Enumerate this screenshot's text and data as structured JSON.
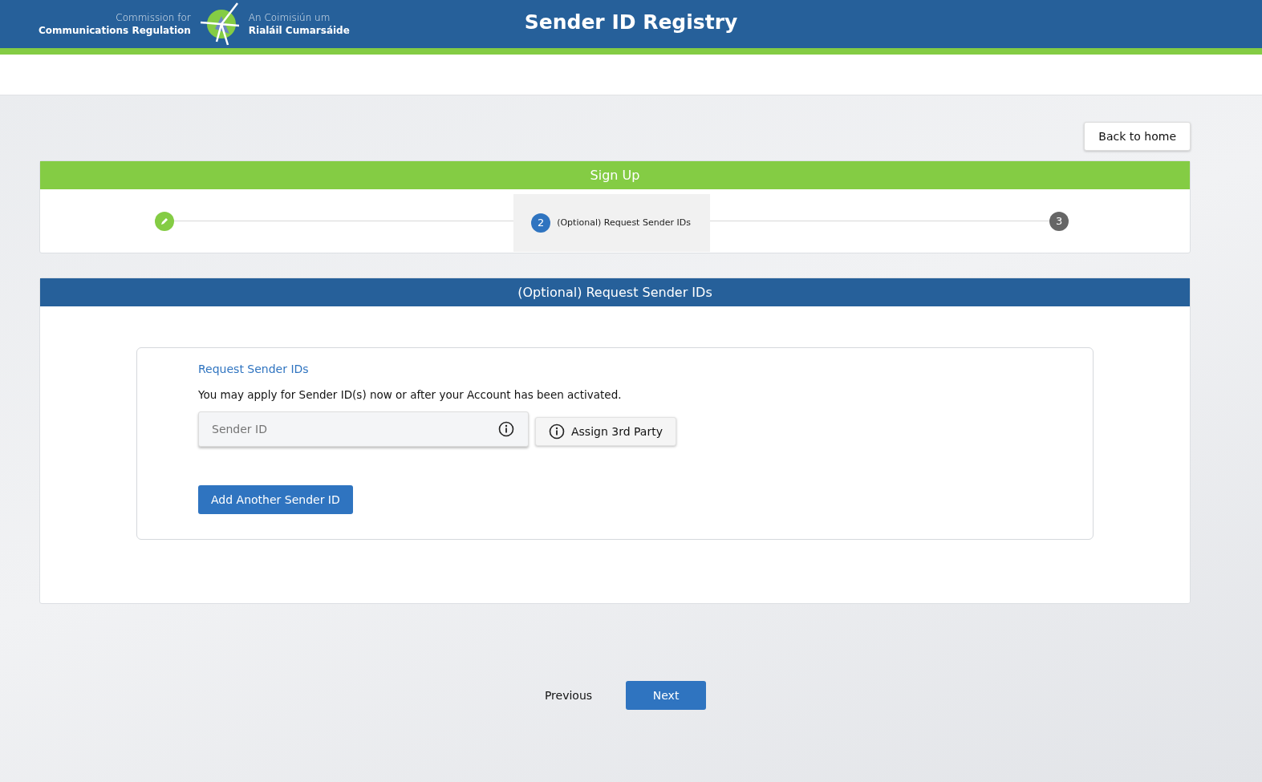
{
  "header": {
    "org_en_line1": "Commission for",
    "org_en_line2": "Communications Regulation",
    "org_ga_line1": "An Coimisiún um",
    "org_ga_line2": "Rialáil Cumarsáide",
    "title": "Sender ID Registry"
  },
  "back_button": "Back to home",
  "signup": {
    "title": "Sign Up",
    "steps": [
      {
        "kind": "done"
      },
      {
        "kind": "current",
        "number": "2",
        "label": "(Optional) Request Sender IDs"
      },
      {
        "kind": "pending",
        "number": "3"
      }
    ]
  },
  "section": {
    "title": "(Optional) Request Sender IDs",
    "heading": "Request Sender IDs",
    "description": "You may apply for Sender ID(s) now or after your Account has been activated.",
    "sender_id_field": {
      "placeholder": "Sender ID"
    },
    "assign_button": "Assign 3rd Party",
    "add_button": "Add Another Sender ID"
  },
  "nav": {
    "previous": "Previous",
    "next": "Next"
  }
}
